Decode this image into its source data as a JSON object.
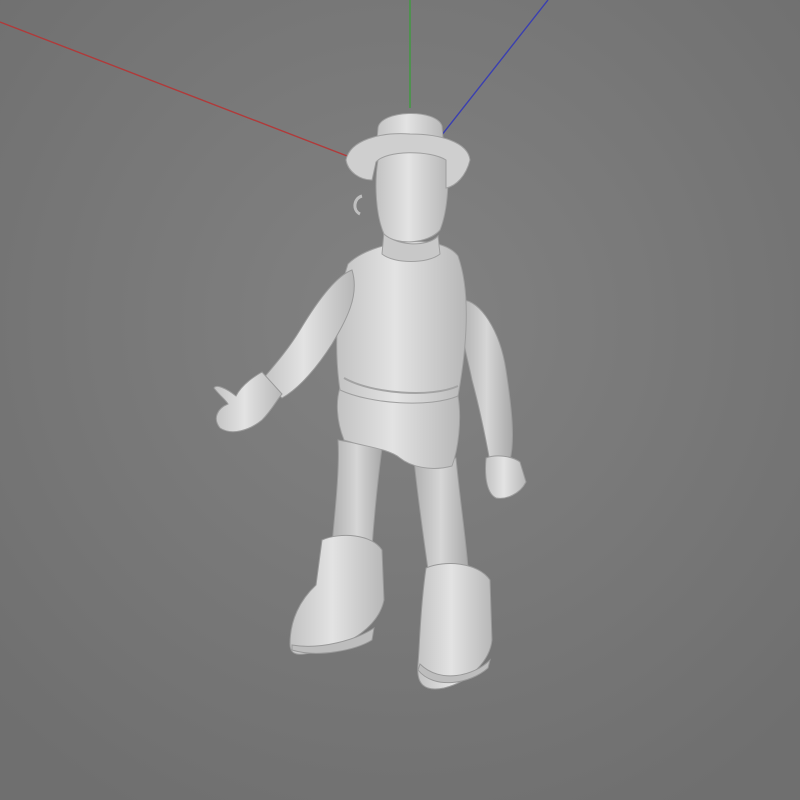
{
  "viewport": {
    "background": "#7a7a7a",
    "model_color": "#d4d4d4"
  },
  "gizmo": {
    "x_axis_color": "#b03a3a",
    "y_axis_color": "#3f9b3f",
    "z_axis_color": "#3a3fb0"
  },
  "icons": {
    "model": "character-model-icon",
    "gizmo": "axis-gizmo-icon"
  }
}
